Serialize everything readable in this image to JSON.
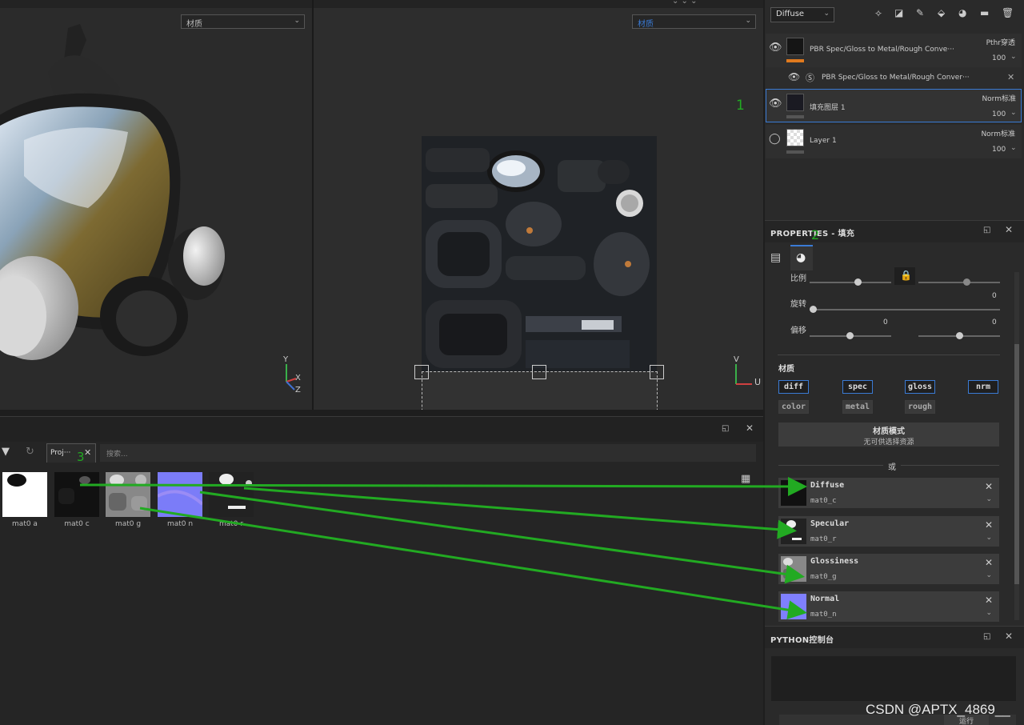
{
  "viewport3d": {
    "channel_select": "材质",
    "axis_labels": {
      "y": "Y",
      "x": "X",
      "z": "Z"
    }
  },
  "viewport2d": {
    "channel_select": "材质",
    "axis_labels": {
      "v": "V",
      "u": "U"
    },
    "annotation_1": "1"
  },
  "layers": {
    "channel_select": "Diffuse",
    "items": [
      {
        "name": "PBR Spec/Gloss to Metal/Rough Conve···",
        "blend": "Pthr穿透",
        "opacity": "100"
      },
      {
        "name": "PBR Spec/Gloss to Metal/Rough Conver···",
        "blend": "",
        "opacity": ""
      },
      {
        "name": "填充图层 1",
        "blend": "Norm标准",
        "opacity": "100"
      },
      {
        "name": "Layer 1",
        "blend": "Norm标准",
        "opacity": "100"
      }
    ]
  },
  "properties": {
    "title": "PROPERTIES - 填充",
    "annotation_2": "2",
    "scale_label": "比例",
    "rotation_label": "旋转",
    "rotation_value": "0",
    "offset_label": "偏移",
    "offset_values": [
      "0",
      "0"
    ],
    "material_header": "材质",
    "channels_top": [
      "diff",
      "spec",
      "gloss",
      "nrm"
    ],
    "channels_bottom": [
      "color",
      "metal",
      "rough"
    ],
    "material_mode_title": "材质模式",
    "material_mode_sub": "无可供选择资源",
    "or_label": "或",
    "slots": [
      {
        "title": "Diffuse",
        "file": "mat0_c"
      },
      {
        "title": "Specular",
        "file": "mat0_r"
      },
      {
        "title": "Glossiness",
        "file": "mat0_g"
      },
      {
        "title": "Normal",
        "file": "mat0_n"
      }
    ]
  },
  "shelf": {
    "tab_label": "Proj···",
    "annotation_3": "3",
    "search_placeholder": "搜索...",
    "thumbnails": [
      {
        "label": "mat0 a"
      },
      {
        "label": "mat0 c"
      },
      {
        "label": "mat0 g"
      },
      {
        "label": "mat0 n"
      },
      {
        "label": "mat0 r"
      }
    ]
  },
  "python": {
    "title": "PYTHON控制台",
    "run_label": "运行"
  },
  "watermark": "CSDN @APTX_4869__",
  "colors": {
    "accent": "#3a7bd5",
    "annotation": "#22aa22"
  }
}
